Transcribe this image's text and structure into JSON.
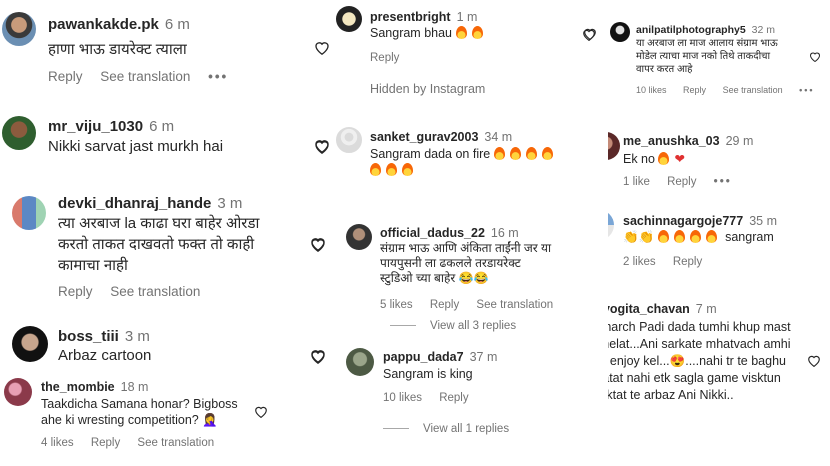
{
  "left": {
    "comments": [
      {
        "user": "pawankakde.pk",
        "time": "6 m",
        "text": "हाणा भाऊ डायरेक्ट त्याला",
        "reply": "Reply",
        "translate": "See translation",
        "more": "•••"
      },
      {
        "user": "mr_viju_1030",
        "time": "6 m",
        "text": "Nikki sarvat jast murkh hai"
      },
      {
        "user": "devki_dhanraj_hande",
        "time": "3 m",
        "text": "त्या अरबाज la काढा घरा बाहेर ओरडा\nकरतो ताकत दाखवतो फक्त तो काही\nकामाचा नाही",
        "reply": "Reply",
        "translate": "See translation"
      },
      {
        "user": "boss_tiii",
        "time": "3 m",
        "text": "Arbaz cartoon"
      },
      {
        "user": "the_mombie",
        "time": "18 m",
        "text": "Taakdicha Samana honar? Bigboss\nahe ki wresting competition? 🤦‍♀️",
        "likes": "4 likes",
        "reply": "Reply",
        "translate": "See translation"
      }
    ]
  },
  "middle": {
    "comments": [
      {
        "user": "presentbright",
        "time": "1 m",
        "text": "Sangram bhau",
        "reply": "Reply"
      },
      {
        "user": "sanket_gurav2003",
        "time": "34 m",
        "text": "Sangram dada on fire"
      },
      {
        "user": "official_dadus_22",
        "time": "16 m",
        "text": "संग्राम भाऊ आणि अंकिता ताईंनी जर या\nपायपुसनी ला ढकलले तरडायरेक्ट\nस्टुडिओ च्या बाहेर 😂😂",
        "likes": "5 likes",
        "reply": "Reply",
        "translate": "See translation",
        "view_replies": "View all 3 replies"
      },
      {
        "user": "pappu_dada7",
        "time": "37 m",
        "text": "Sangram is king",
        "likes": "10 likes",
        "reply": "Reply",
        "view_replies": "View all 1 replies"
      }
    ],
    "hidden_by": "Hidden by Instagram"
  },
  "right": {
    "comments": [
      {
        "user": "anilpatilphotography5",
        "time": "32 m",
        "text": "या अरबाज ला माज आलाय संग्राम भाऊ\nमोडेल त्याचा माज नको तिथे ताकदीचा\nवापर करत आहे",
        "likes": "10 likes",
        "reply": "Reply",
        "translate": "See translation",
        "more": "•••"
      },
      {
        "user": "me_anushka_03",
        "time": "29 m",
        "text": "Ek no",
        "likes": "1 like",
        "reply": "Reply",
        "more": "•••"
      },
      {
        "user": "sachinnagargoje777",
        "time": "35 m",
        "text": "sangram",
        "likes": "2 likes",
        "reply": "Reply"
      },
      {
        "user": "yyogita_chavan",
        "time": "7 m",
        "text": "Kharch Padi dada tumhi khup mast\nkhelat...Ani sarkate mhatvach amhi\nte enjoy kel...😍....nahi tr te baghu\nvatat nahi etk sagla game visktun\ntaktat te arbaz Ani Nikki.."
      }
    ]
  },
  "colors": {
    "text": "#262626",
    "muted": "#737373",
    "heart_red": "#e03131"
  },
  "icons": {
    "like": "heart-outline-icon",
    "fire": "fire-emoji-icon",
    "chevron": "chevron-down-icon"
  }
}
